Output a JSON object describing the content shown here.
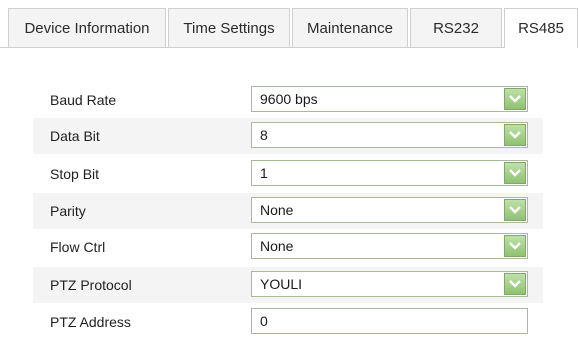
{
  "tabs": [
    {
      "label": "Device Information"
    },
    {
      "label": "Time Settings"
    },
    {
      "label": "Maintenance"
    },
    {
      "label": "RS232"
    },
    {
      "label": "RS485",
      "active": true
    }
  ],
  "form": {
    "baud_rate": {
      "label": "Baud Rate",
      "value": "9600 bps"
    },
    "data_bit": {
      "label": "Data Bit",
      "value": "8"
    },
    "stop_bit": {
      "label": "Stop Bit",
      "value": "1"
    },
    "parity": {
      "label": "Parity",
      "value": "None"
    },
    "flow_ctrl": {
      "label": "Flow Ctrl",
      "value": "None"
    },
    "ptz_protocol": {
      "label": "PTZ Protocol",
      "value": "YOULI"
    },
    "ptz_address": {
      "label": "PTZ Address",
      "value": "0"
    }
  },
  "colors": {
    "dropdown_button": "#8fc271",
    "row_shade": "#f4f4f4",
    "field_border": "#a9b99a"
  },
  "icons": {
    "dropdown": "chevron-down-icon"
  }
}
